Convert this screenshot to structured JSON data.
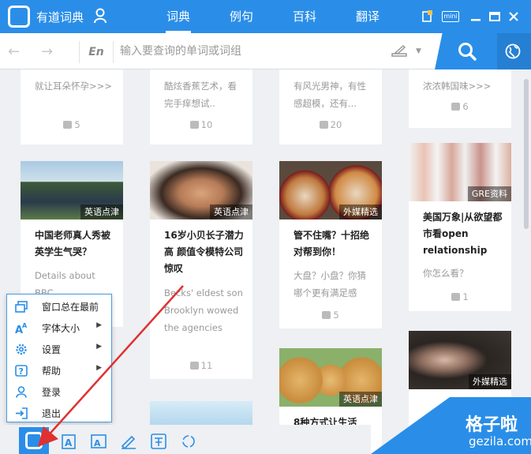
{
  "app": {
    "name": "有道词典"
  },
  "tabs": [
    {
      "label": "词典"
    },
    {
      "label": "例句"
    },
    {
      "label": "百科"
    },
    {
      "label": "翻译"
    }
  ],
  "search": {
    "placeholder": "输入要查询的单词或词组",
    "lang": "En"
  },
  "cards": [
    {
      "desc": "就让耳朵怀孕>>>",
      "likes": "5"
    },
    {
      "desc": "酷炫香蕉艺术，看完手痒想试..",
      "likes": "10"
    },
    {
      "desc": "有风光男神，有性感超模，还有...",
      "likes": "20"
    },
    {
      "desc": "浓浓韩国味>>>",
      "likes": "6"
    },
    {
      "badge": "英语点津",
      "title": "中国老师真人秀被英学生气哭？",
      "desc": "Details about BBC..."
    },
    {
      "badge": "英语点津",
      "title": "16岁小贝长子潜力高 颜值令模特公司惊叹",
      "desc": "Becks' eldest son Brooklyn wowed the agencies",
      "likes": "11"
    },
    {
      "badge": "外媒精选",
      "title": "管不住嘴？十招绝对帮到你！",
      "desc": "大盘？小盘？你猜哪个更有满足感",
      "likes": "5"
    },
    {
      "badge": "GRE资料",
      "title": "美国万象|从欲望都市看open relationship",
      "desc": "你怎么看？",
      "likes": "1"
    },
    {
      "badge": "英语点津",
      "title": "8种方式让生活更..."
    },
    {
      "badge": "外媒精选"
    }
  ],
  "menu": [
    {
      "label": "窗口总在最前",
      "icon": "window-icon",
      "arrow": false
    },
    {
      "label": "字体大小",
      "icon": "font-size-icon",
      "arrow": true
    },
    {
      "label": "设置",
      "icon": "gear-icon",
      "arrow": true
    },
    {
      "label": "帮助",
      "icon": "help-icon",
      "arrow": true
    },
    {
      "label": "登录",
      "icon": "user-icon",
      "arrow": false
    },
    {
      "label": "退出",
      "icon": "exit-icon",
      "arrow": false
    }
  ],
  "window_controls": {
    "mini_label": "mini"
  },
  "watermark": {
    "title": "格子啦",
    "url": "gezila.com"
  },
  "colors": {
    "accent": "#2a8ee8",
    "menu_border": "#4a9de0",
    "watermark": "#2a8ee8"
  }
}
